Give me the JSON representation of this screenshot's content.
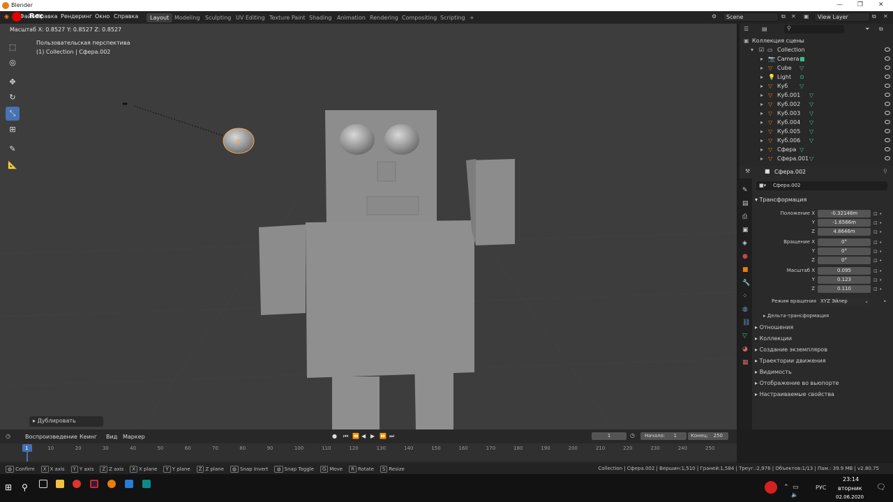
{
  "window": {
    "title": "Blender"
  },
  "menu": {
    "file": "Файл",
    "edit": "Правка",
    "render": "Рендеринг",
    "window": "Окно",
    "help": "Справка"
  },
  "recorder": {
    "label": "Rec"
  },
  "workspaces": [
    "Layout",
    "Modeling",
    "Sculpting",
    "UV Editing",
    "Texture Paint",
    "Shading",
    "Animation",
    "Rendering",
    "Compositing",
    "Scripting"
  ],
  "add_workspace": "+",
  "scene": {
    "label": "Scene"
  },
  "view_layer": {
    "label": "View Layer"
  },
  "viewport": {
    "header_readout": "Масштаб X: 0.8527   Y: 0.8527   Z: 0.8527",
    "view_name": "Пользовательская перспектива",
    "view_object": "(1) Collection | Сфера.002",
    "last_op": "Дублировать"
  },
  "toolbar": [
    "cursor-select",
    "cursor-3d",
    "move",
    "rotate",
    "scale",
    "transform",
    "annotate",
    "measure"
  ],
  "outliner": {
    "root": "Коллекция сцены",
    "collection": "Collection",
    "items": [
      {
        "name": "Camera",
        "type": "camera"
      },
      {
        "name": "Cube",
        "type": "mesh"
      },
      {
        "name": "Light",
        "type": "light"
      },
      {
        "name": "Куб",
        "type": "mesh"
      },
      {
        "name": "Куб.001",
        "type": "mesh"
      },
      {
        "name": "Куб.002",
        "type": "mesh"
      },
      {
        "name": "Куб.003",
        "type": "mesh"
      },
      {
        "name": "Куб.004",
        "type": "mesh"
      },
      {
        "name": "Куб.005",
        "type": "mesh"
      },
      {
        "name": "Куб.006",
        "type": "mesh"
      },
      {
        "name": "Сфера",
        "type": "mesh"
      },
      {
        "name": "Сфера.001",
        "type": "mesh"
      }
    ]
  },
  "properties": {
    "object_name": "Сфера.002",
    "object_field": "Сфера.002",
    "section_transform": "Трансформация",
    "location_label": "Положение X",
    "rotation_label": "Вращение X",
    "scale_label": "Масштаб X",
    "y": "Y",
    "z": "Z",
    "location": [
      "-0.32148m",
      "-1.6566m",
      "4.8646m"
    ],
    "rotation": [
      "0°",
      "0°",
      "0°"
    ],
    "scale": [
      "0.095",
      "0.123",
      "0.110"
    ],
    "rotation_mode_label": "Режим вращения",
    "rotation_mode_value": "XYZ Эйлер",
    "delta": "Дельта-трансформация",
    "sections": [
      "Отношения",
      "Коллекции",
      "Создание экземпляров",
      "Траектории движения",
      "Видимость",
      "Отображение во вьюпорте",
      "Настраиваемые свойства"
    ]
  },
  "timeline": {
    "playback": "Воспроизведение",
    "keying": "Кеинг",
    "view": "Вид",
    "marker": "Маркер",
    "current_frame": "1",
    "start_label": "Начало:",
    "start": "1",
    "end_label": "Конец:",
    "end": "250",
    "frames": [
      "1",
      "10",
      "20",
      "30",
      "40",
      "50",
      "60",
      "70",
      "80",
      "90",
      "100",
      "110",
      "120",
      "130",
      "140",
      "150",
      "160",
      "170",
      "180",
      "190",
      "200",
      "210",
      "220",
      "230",
      "240",
      "250"
    ]
  },
  "status": {
    "keys": [
      {
        "k": "",
        "t": "Confirm"
      },
      {
        "k": "X",
        "t": "X axis"
      },
      {
        "k": "Y",
        "t": "Y axis"
      },
      {
        "k": "Z",
        "t": "Z axis"
      },
      {
        "k": "X",
        "t": "X plane"
      },
      {
        "k": "Y",
        "t": "Y plane"
      },
      {
        "k": "Z",
        "t": "Z plane"
      },
      {
        "k": "",
        "t": "Snap Invert"
      },
      {
        "k": "",
        "t": "Snap Toggle"
      },
      {
        "k": "G",
        "t": "Move"
      },
      {
        "k": "R",
        "t": "Rotate"
      },
      {
        "k": "S",
        "t": "Resize"
      }
    ],
    "stats": "Collection | Сфера.002 | Вершин:1,510 | Граней:1,584 | Треуг.:2,976 | Объектов:1/13 | Пам.: 39.9 MB | v2.80.75"
  },
  "taskbar": {
    "time": "23:14",
    "day": "вторник",
    "date": "02.06.2020",
    "lang": "РУС"
  },
  "colors": {
    "accent": "#4772b3",
    "mesh_icon": "#37c28a",
    "orange": "#e87d0d",
    "viewport": "#3d3d3d"
  }
}
